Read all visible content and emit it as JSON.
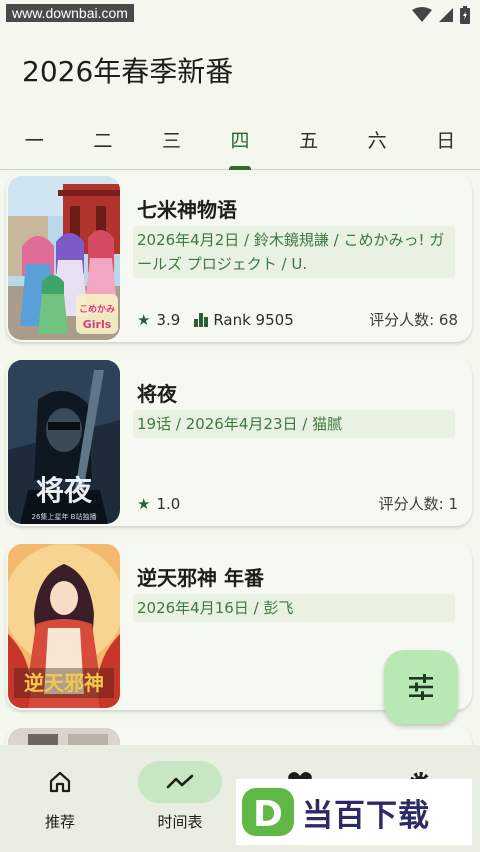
{
  "status_bar": {
    "watermark_url": "www.downbai.com",
    "icons": [
      "wifi-icon",
      "signal-icon",
      "battery-icon"
    ]
  },
  "header": {
    "title": "2026年春季新番"
  },
  "weekday_tabs": {
    "items": [
      "一",
      "二",
      "三",
      "四",
      "五",
      "六",
      "日"
    ],
    "active_index": 3
  },
  "anime_list": [
    {
      "title": "七米神物语",
      "meta": "2026年4月2日 / 鈴木鏡規謙 / こめかみっ! ガールズ プロジェクト / U.",
      "rating": "3.9",
      "rank_label": "Rank 9505",
      "raters": "评分人数: 68",
      "poster_text": "こめかみっ! Girls"
    },
    {
      "title": "将夜",
      "meta": "19话 / 2026年4月23日 / 猫腻",
      "rating": "1.0",
      "raters": "评分人数: 1",
      "poster_text": "将夜",
      "poster_caption": "26集上星年 B站独播"
    },
    {
      "title": "逆天邪神 年番",
      "meta": "2026年4月16日 / 彭飞",
      "poster_text": "逆天邪神"
    }
  ],
  "fab": {
    "icon": "tune-icon"
  },
  "bottom_nav": {
    "items": [
      {
        "label": "推荐",
        "icon": "home-icon"
      },
      {
        "label": "时间表",
        "icon": "trending-icon"
      },
      {
        "label": "",
        "icon": "heart-icon"
      },
      {
        "label": "",
        "icon": "gear-icon"
      }
    ],
    "active_index": 1
  },
  "overlay_brand": {
    "text": "当百下载",
    "logo_letter": "D"
  },
  "colors": {
    "accent": "#2f6a33",
    "meta_text": "#3c7a40",
    "fab_bg": "#b8e9b4",
    "nav_active": "#c9e6c4",
    "background": "#f3f7ee"
  }
}
